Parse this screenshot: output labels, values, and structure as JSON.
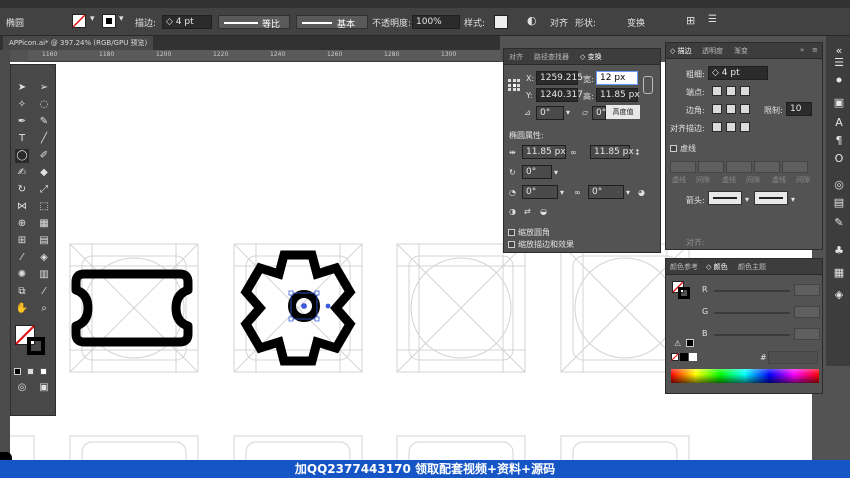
{
  "controlbar": {
    "label_object": "椭圆",
    "label_stroke": "描边:",
    "stroke_weight": "4 pt",
    "profile": "等比",
    "brush": "基本",
    "label_opacity": "不透明度:",
    "opacity": "100%",
    "label_style": "样式:",
    "label_align": "对齐",
    "label_shape": "形状:",
    "label_transform": "变换"
  },
  "document": {
    "tab": "APPicon.ai* @ 397.24% (RGB/GPU 预览)"
  },
  "ruler": {
    "ticks": [
      "1160",
      "1180",
      "1200",
      "1220",
      "1240",
      "1260",
      "1280",
      "1300"
    ]
  },
  "transform_panel": {
    "tabs": [
      "对齐",
      "路径查找器",
      "◇ 变换"
    ],
    "x_label": "X:",
    "x": "1259.215",
    "y_label": "Y:",
    "y": "1240.317",
    "w_label": "宽:",
    "w": "12 px",
    "h_label": "高:",
    "h": "11.85 px",
    "angle": "0°",
    "shear": "0°",
    "button": "高度值",
    "ellipse_props": "椭圆属性:",
    "ew": "11.85 px",
    "eh": "11.85 px",
    "pie_start": "0°",
    "pie_a": "0°",
    "pie_b": "0°",
    "scale_corners": "缩放圆角",
    "scale_strokes": "缩放描边和效果"
  },
  "stroke_panel": {
    "tabs": [
      "◇ 描边",
      "透明度",
      "渐变"
    ],
    "weight_label": "粗细:",
    "weight": "4 pt",
    "cap_label": "端点:",
    "corner_label": "边角:",
    "limit_label": "限制:",
    "limit": "10",
    "align_label": "对齐描边:",
    "dashed": "虚线",
    "dash_labels": [
      "虚线",
      "间隙",
      "虚线",
      "间隙",
      "虚线",
      "间隙"
    ],
    "arrow_label": "箭头:",
    "align2": "对齐:"
  },
  "color_panel": {
    "tabs": [
      "颜色参考",
      "◇ 颜色",
      "颜色主题"
    ],
    "r": "R",
    "g": "G",
    "b": "B",
    "hash": "#"
  },
  "banner": {
    "text": "加QQ2377443170 领取配套视频+资料+源码"
  },
  "colors": {
    "banner": "#1555c6",
    "canvas": "#ffffff",
    "panel": "#535353"
  }
}
